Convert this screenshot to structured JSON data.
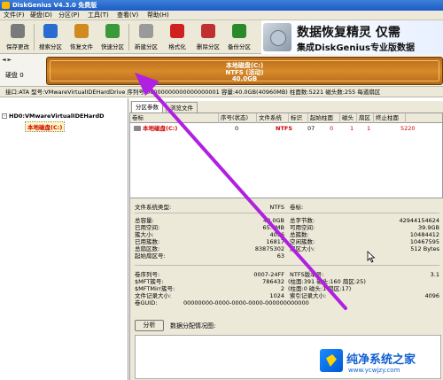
{
  "window": {
    "title": "DiskGenius V4.3.0 免费版"
  },
  "menu": [
    "文件(F)",
    "硬盘(D)",
    "分区(P)",
    "工具(T)",
    "查看(V)",
    "帮助(H)"
  ],
  "toolbar": [
    {
      "label": "保存更改",
      "icon": "save-icon",
      "color": "#7a7a7a"
    },
    {
      "label": "搜索分区",
      "icon": "search-icon",
      "color": "#2b6cd0"
    },
    {
      "label": "恢复文件",
      "icon": "recover-icon",
      "color": "#d08a20"
    },
    {
      "label": "快速分区",
      "icon": "quick-partition-icon",
      "color": "#3a9a3a"
    },
    {
      "label": "新建分区",
      "icon": "new-partition-icon",
      "color": "#9a9a9a"
    },
    {
      "label": "格式化",
      "icon": "format-icon",
      "color": "#d02020"
    },
    {
      "label": "删除分区",
      "icon": "delete-partition-icon",
      "color": "#c03030"
    },
    {
      "label": "备份分区",
      "icon": "backup-icon",
      "color": "#2a8a2a"
    }
  ],
  "banner": {
    "big": "数据恢复精灵  仅需",
    "sub": "集成DiskGenius专业版数据"
  },
  "diskmap": {
    "disk_label": "硬盘 0",
    "nav": "◄ ►",
    "partition_name": "本地磁盘(C:)",
    "partition_fs": "NTFS (活动)",
    "partition_size": "40.0GB"
  },
  "infoline": "接口:ATA  型号:VMwareVirtualIDEHardDrive  序列号:00000000000000000001  容量:40.0GB(40960MB)  柱面数:5221  磁头数:255  每道扇区",
  "tree": {
    "disk": "HD0:VMwareVirtualIDEHardD",
    "partition": "本地磁盘(C:)"
  },
  "tabs": [
    "分区参数",
    "浏览文件"
  ],
  "table": {
    "headers": [
      "卷标",
      "序号(状态)",
      "文件系统",
      "标识",
      "起始柱面",
      "磁头",
      "扇区",
      "终止柱面"
    ],
    "row": {
      "name": "本地磁盘(C:)",
      "index": "0",
      "fs": "NTFS",
      "id": "07",
      "start_cyl": "0",
      "head": "1",
      "sector": "1",
      "end_cyl": "5220"
    }
  },
  "details": {
    "fs_type_label": "文件系统类型:",
    "fs_type": "NTFS",
    "volume_label": "卷标:",
    "left": [
      {
        "k": "总容量:",
        "v": "40.0GB"
      },
      {
        "k": "已用空间:",
        "v": "65.7MB"
      },
      {
        "k": "簇大小:",
        "v": "4096"
      },
      {
        "k": "已用簇数:",
        "v": "16817"
      },
      {
        "k": "总扇区数:",
        "v": "83875302"
      },
      {
        "k": "起始扇区号:",
        "v": "63"
      }
    ],
    "right": [
      {
        "k": "总字节数:",
        "v": "42944154624"
      },
      {
        "k": "可用空间:",
        "v": "39.9GB"
      },
      {
        "k": "总簇数:",
        "v": "10484412"
      },
      {
        "k": "空闲簇数:",
        "v": "10467595"
      },
      {
        "k": "扇区大小:",
        "v": "512 Bytes"
      }
    ],
    "ntfs_left": [
      {
        "k": "卷序列号:",
        "v": "0007-24FF"
      },
      {
        "k": "$MFT簇号:",
        "v": "786432"
      },
      {
        "k": "$MFTMirr簇号:",
        "v": "2"
      },
      {
        "k": "文件记录大小:",
        "v": "1024"
      },
      {
        "k": "卷GUID:",
        "v": "00000000-0000-0000-0000-000000000000"
      }
    ],
    "ntfs_right": [
      {
        "k": "NTFS版本号:",
        "v": "3.1"
      },
      {
        "k": "(柱面:391 磁头:160 扇区:25)",
        "v": ""
      },
      {
        "k": "(柱面:0 磁头:1 扇区:17)",
        "v": ""
      },
      {
        "k": "索引记录大小:",
        "v": "4096"
      }
    ]
  },
  "analyze_button": "分析",
  "data_map_label": "数据分配情况图:",
  "watermark": {
    "title": "纯净系统之家",
    "url": "www.ycwjzy.com"
  },
  "colors": {
    "arrow": "#b020e0",
    "partition": "#c87a20",
    "accent": "#1060d0"
  }
}
